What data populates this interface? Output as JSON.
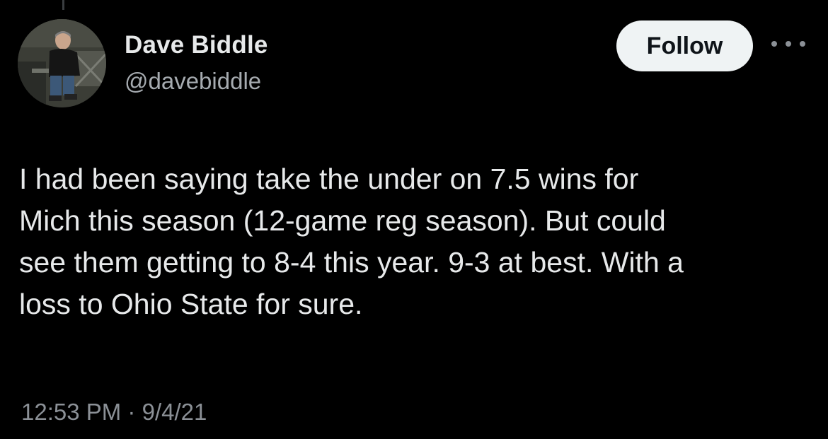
{
  "author": {
    "display_name": "Dave Biddle",
    "handle": "@davebiddle"
  },
  "actions": {
    "follow_label": "Follow",
    "more_icon": "more-horizontal-icon"
  },
  "tweet": {
    "lines": [
      "I had been saying take the under on 7.5 wins for",
      "Mich this season (12-game reg season). But could",
      "see them getting to 8-4 this year. 9-3 at best. With a",
      "loss to Ohio State for sure."
    ],
    "time": "12:53 PM",
    "separator": "·",
    "date": "9/4/21"
  },
  "colors": {
    "background": "#000000",
    "primary_text": "#e7e9ea",
    "secondary_text": "#8b9096",
    "follow_button_bg": "#eff3f4",
    "follow_button_text": "#0f1419"
  }
}
